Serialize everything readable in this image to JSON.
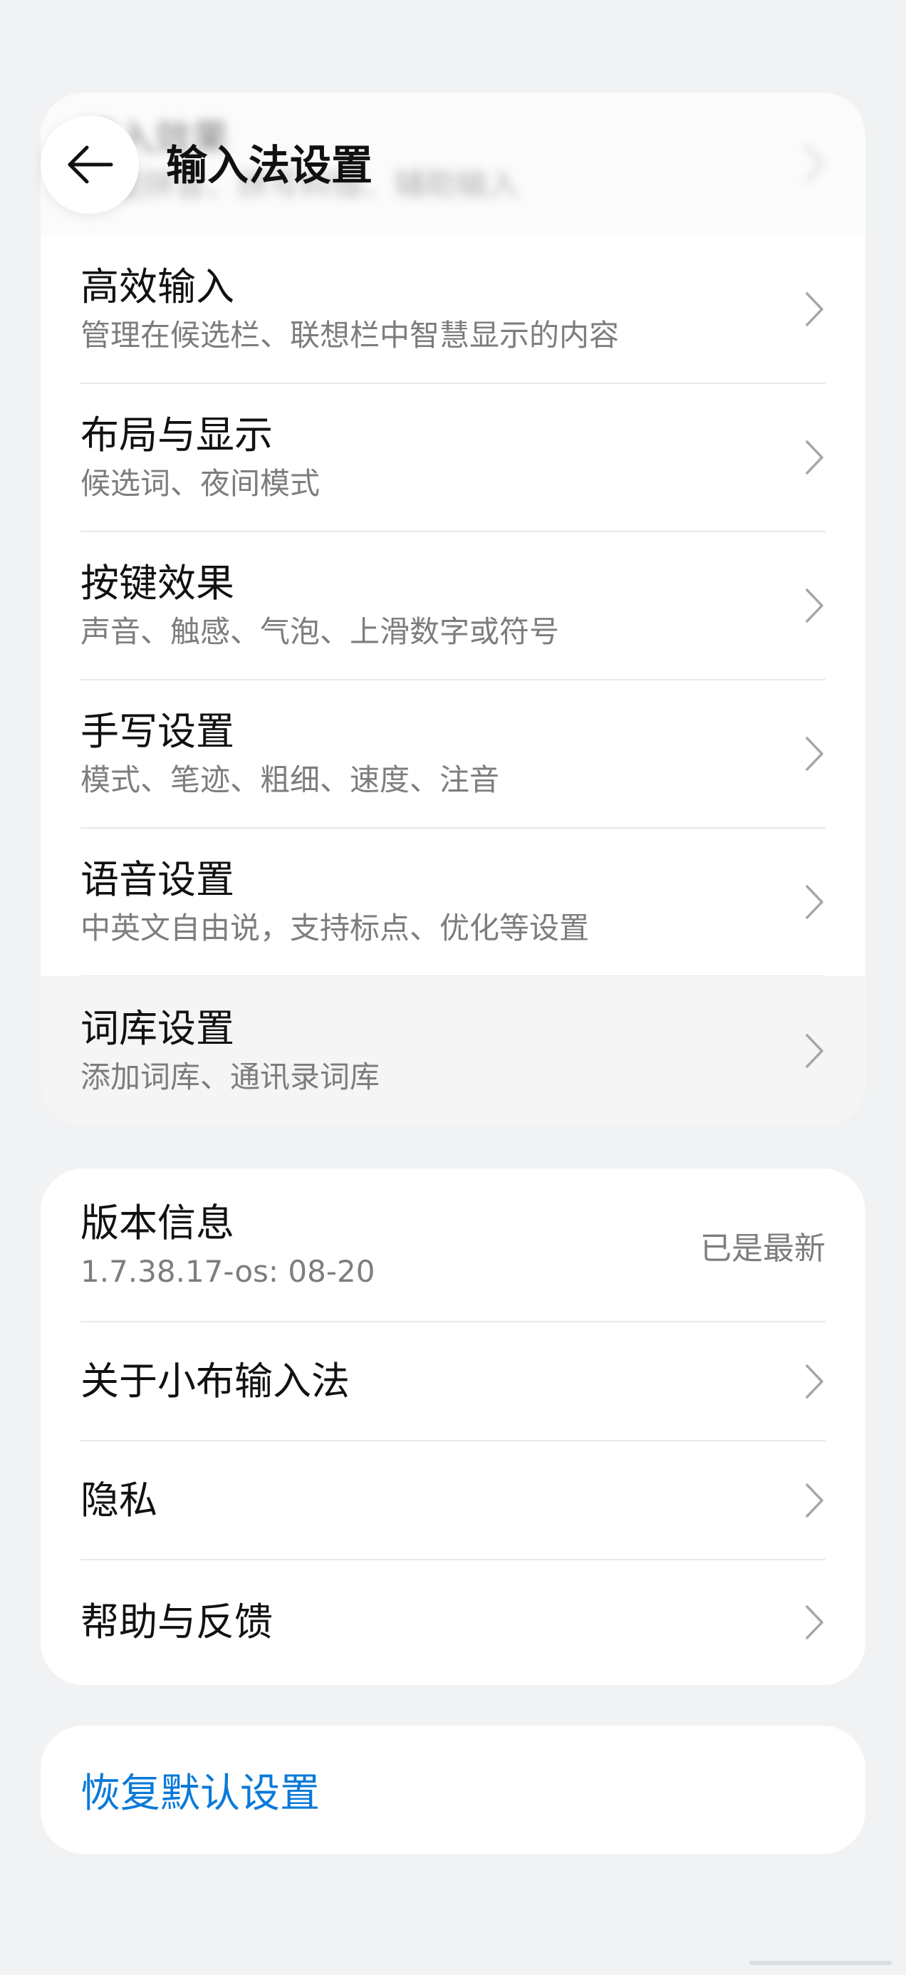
{
  "header": {
    "title": "输入法设置",
    "back_icon": "arrow-left-icon",
    "blurred_item_title": "输入效果",
    "blurred_item_subtitle": "智能拼音、拼写纠错、辅助输入"
  },
  "settings_group": {
    "items": [
      {
        "title": "高效输入",
        "subtitle": "管理在候选栏、联想栏中智慧显示的内容"
      },
      {
        "title": "布局与显示",
        "subtitle": "候选词、夜间模式"
      },
      {
        "title": "按键效果",
        "subtitle": "声音、触感、气泡、上滑数字或符号"
      },
      {
        "title": "手写设置",
        "subtitle": "模式、笔迹、粗细、速度、注音"
      },
      {
        "title": "语音设置",
        "subtitle": "中英文自由说，支持标点、优化等设置"
      },
      {
        "title": "词库设置",
        "subtitle": "添加词库、通讯录词库"
      }
    ]
  },
  "about_group": {
    "version": {
      "title": "版本信息",
      "version_text": "1.7.38.17-os: 08-20",
      "status": "已是最新"
    },
    "items": [
      {
        "title": "关于小布输入法"
      },
      {
        "title": "隐私"
      },
      {
        "title": "帮助与反馈"
      }
    ]
  },
  "restore": {
    "label": "恢复默认设置"
  },
  "colors": {
    "background": "#f1f2f4",
    "card": "#ffffff",
    "accent_link": "#0a7ad8",
    "secondary_text": "#7d7d7d",
    "divider": "#e8e8ea"
  }
}
